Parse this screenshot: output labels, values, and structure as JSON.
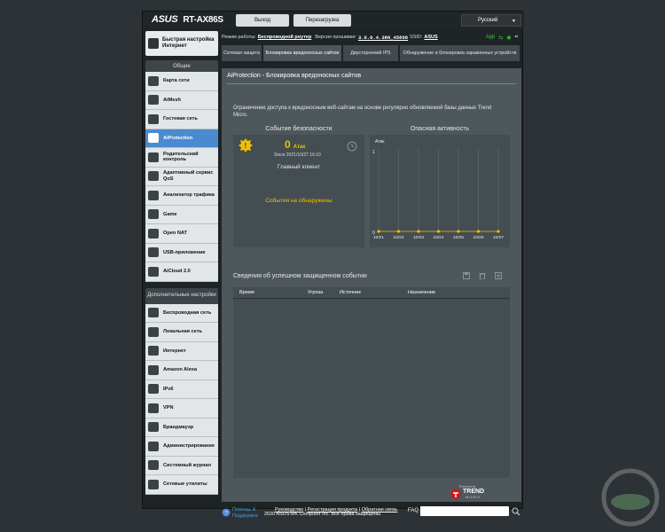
{
  "header": {
    "brand": "ASUS",
    "model": "RT-AX86S",
    "logout_label": "Выход",
    "reboot_label": "Перезагрузка",
    "language": "Русский"
  },
  "infobar": {
    "mode_label": "Режим работы:",
    "mode_value": "Беспроводной роутер",
    "fw_label": "Версия прошивки:",
    "fw_value": "3.0.0.4.386_45898",
    "ssid_label": "SSID:",
    "ssid_value": "ASUS",
    "app_label": "App"
  },
  "sidebar": {
    "quick_setup": "Быстрая настройка Интернет",
    "general_header": "Общие",
    "general_items": [
      "Карта сети",
      "AiMesh",
      "Гостевая сеть",
      "AiProtection",
      "Родительский контроль",
      "Адаптивный сервис QoS",
      "Анализатор трафика",
      "Game",
      "Open NAT",
      "USB-приложение",
      "AiCloud 2.0"
    ],
    "advanced_header": "Дополнительные настройки",
    "advanced_items": [
      "Беспроводная сеть",
      "Локальная сеть",
      "Интернет",
      "Amazon Alexa",
      "IPv6",
      "VPN",
      "Брандмауэр",
      "Администрирование",
      "Системный журнал",
      "Сетевые утилиты"
    ]
  },
  "tabs": [
    "Сетевая защита",
    "Блокировка вредоносных сайтов",
    "Двусторонний IPS",
    "Обнаружение и блокировка зараженных устройств"
  ],
  "panel": {
    "title": "AiProtection - Блокировка вредоносных сайтов",
    "description": "Ограничение доступа к вредоносным веб-сайтам на основе регулярно обновляемой базы данных Trend Micro.",
    "event_heading": "Событие безопасности",
    "activity_heading": "Опасная активность",
    "attack_count": "0",
    "attack_label": "Атак",
    "since": "Since 2021/10/27 16:10",
    "main_client": "Главный клиент",
    "no_events": "События не обнаружены",
    "details_heading": "Сведения об успешном защищенном событии",
    "table_headers": [
      "Время",
      "Угроза",
      "Источник",
      "Назначение"
    ]
  },
  "chart_data": {
    "type": "line",
    "ylabel": "Атак",
    "x": [
      "10/21",
      "10/22",
      "10/23",
      "10/24",
      "10/25",
      "10/26",
      "10/27"
    ],
    "series": [
      {
        "values": [
          0,
          0,
          0,
          0,
          0,
          0,
          0
        ]
      }
    ],
    "ylim": [
      0,
      1
    ],
    "yticks": [
      "1",
      "0"
    ],
    "grid": true
  },
  "footer": {
    "help": "Помощь & Поддержка",
    "manual": "Руководство",
    "register": "Регистрация продукта",
    "feedback": "Обратная связь",
    "faq": "FAQ",
    "copyright": "2020 ASUSTeK Computer Inc. Все права защищены.",
    "trend_powered": "Powered by",
    "trend_name": "TREND",
    "trend_sub": "MICRO"
  },
  "colors": {
    "accent": "#4a8bd0",
    "attack": "#f0c000",
    "warning_text": "#f0c000"
  }
}
